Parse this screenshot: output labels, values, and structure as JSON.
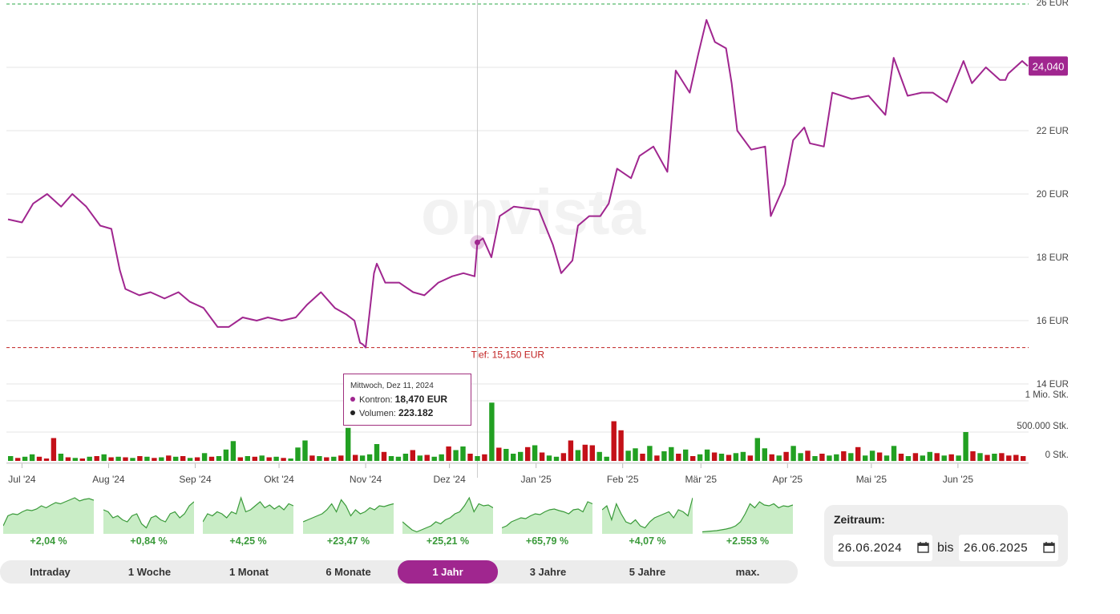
{
  "chart_data": {
    "type": "line",
    "series": [
      {
        "name": "Kontron",
        "x": [
          "2024-06-26",
          "2024-07-01",
          "2024-07-05",
          "2024-07-10",
          "2024-07-15",
          "2024-07-19",
          "2024-07-24",
          "2024-07-29",
          "2024-08-02",
          "2024-08-05",
          "2024-08-07",
          "2024-08-12",
          "2024-08-16",
          "2024-08-21",
          "2024-08-26",
          "2024-08-30",
          "2024-09-04",
          "2024-09-09",
          "2024-09-13",
          "2024-09-18",
          "2024-09-23",
          "2024-09-27",
          "2024-10-02",
          "2024-10-07",
          "2024-10-11",
          "2024-10-16",
          "2024-10-21",
          "2024-10-25",
          "2024-10-28",
          "2024-10-30",
          "2024-10-31",
          "2024-11-01",
          "2024-11-04",
          "2024-11-05",
          "2024-11-08",
          "2024-11-13",
          "2024-11-18",
          "2024-11-22",
          "2024-11-27",
          "2024-12-02",
          "2024-12-06",
          "2024-12-10",
          "2024-12-11",
          "2024-12-13",
          "2024-12-16",
          "2024-12-19",
          "2024-12-24",
          "2025-01-02",
          "2025-01-07",
          "2025-01-10",
          "2025-01-14",
          "2025-01-16",
          "2025-01-20",
          "2025-01-24",
          "2025-01-27",
          "2025-01-30",
          "2025-02-04",
          "2025-02-07",
          "2025-02-12",
          "2025-02-17",
          "2025-02-20",
          "2025-02-25",
          "2025-02-28",
          "2025-03-03",
          "2025-03-06",
          "2025-03-10",
          "2025-03-12",
          "2025-03-14",
          "2025-03-19",
          "2025-03-24",
          "2025-03-26",
          "2025-03-31",
          "2025-04-03",
          "2025-04-07",
          "2025-04-09",
          "2025-04-14",
          "2025-04-17",
          "2025-04-24",
          "2025-04-30",
          "2025-05-06",
          "2025-05-09",
          "2025-05-14",
          "2025-05-19",
          "2025-05-23",
          "2025-05-28",
          "2025-06-03",
          "2025-06-06",
          "2025-06-11",
          "2025-06-16",
          "2025-06-18",
          "2025-06-19",
          "2025-06-24",
          "2025-06-26"
        ],
        "y": [
          19.2,
          19.1,
          19.7,
          20.0,
          19.6,
          20.0,
          19.6,
          19.0,
          18.9,
          17.6,
          17.0,
          16.8,
          16.9,
          16.7,
          16.9,
          16.6,
          16.4,
          15.8,
          15.8,
          16.1,
          16.0,
          16.1,
          16.0,
          16.1,
          16.5,
          16.9,
          16.4,
          16.2,
          16.0,
          15.3,
          15.25,
          15.15,
          17.5,
          17.8,
          17.2,
          17.2,
          16.9,
          16.8,
          17.2,
          17.4,
          17.5,
          17.4,
          18.47,
          18.6,
          18.0,
          19.3,
          19.6,
          19.5,
          18.4,
          17.5,
          17.9,
          19.0,
          19.3,
          19.3,
          19.7,
          20.8,
          20.5,
          21.2,
          21.5,
          20.7,
          23.9,
          23.2,
          24.4,
          25.5,
          24.8,
          24.6,
          23.5,
          22.0,
          21.4,
          21.5,
          19.3,
          20.3,
          21.7,
          22.1,
          21.6,
          21.5,
          23.2,
          23.0,
          23.1,
          22.5,
          24.3,
          23.1,
          23.2,
          23.2,
          22.9,
          24.2,
          23.5,
          24.0,
          23.6,
          23.6,
          23.8,
          24.2,
          24.04
        ]
      }
    ],
    "volume": {
      "name": "Volumen",
      "values": [
        80000,
        50000,
        70000,
        110000,
        70000,
        40000,
        380000,
        120000,
        60000,
        50000,
        40000,
        70000,
        80000,
        110000,
        60000,
        70000,
        60000,
        50000,
        80000,
        70000,
        50000,
        60000,
        90000,
        70000,
        80000,
        50000,
        60000,
        130000,
        70000,
        80000,
        190000,
        330000,
        60000,
        80000,
        70000,
        90000,
        60000,
        70000,
        50000,
        40000,
        223182,
        340000,
        90000,
        80000,
        60000,
        70000,
        90000,
        550000,
        100000,
        90000,
        110000,
        280000,
        150000,
        80000,
        70000,
        120000,
        180000,
        90000,
        100000,
        70000,
        110000,
        240000,
        180000,
        240000,
        120000,
        80000,
        110000,
        970000,
        220000,
        200000,
        120000,
        150000,
        230000,
        260000,
        140000,
        90000,
        70000,
        130000,
        340000,
        180000,
        270000,
        260000,
        150000,
        70000,
        660000,
        510000,
        170000,
        210000,
        120000,
        250000,
        90000,
        160000,
        230000,
        120000,
        190000,
        80000,
        110000,
        190000,
        140000,
        120000,
        100000,
        130000,
        150000,
        90000,
        380000,
        210000,
        110000,
        90000,
        150000,
        250000,
        130000,
        170000,
        80000,
        120000,
        90000,
        110000,
        160000,
        130000,
        230000,
        90000,
        170000,
        140000,
        90000,
        250000,
        120000,
        80000,
        130000,
        90000,
        150000,
        130000,
        90000,
        110000,
        90000,
        480000,
        160000,
        130000,
        100000,
        120000,
        130000,
        90000,
        100000,
        80000
      ],
      "up": [
        1,
        0,
        1,
        1,
        0,
        0,
        0,
        1,
        0,
        1,
        0,
        1,
        0,
        1,
        0,
        1,
        0,
        1,
        0,
        1,
        0,
        1,
        0,
        1,
        0,
        1,
        0,
        1,
        0,
        1,
        1,
        1,
        0,
        1,
        0,
        1,
        0,
        1,
        0,
        1,
        1,
        1,
        0,
        1,
        0,
        1,
        0,
        1,
        0,
        1,
        1,
        1,
        0,
        1,
        1,
        1,
        0,
        1,
        0,
        1,
        1,
        0,
        1,
        1,
        0,
        1,
        0,
        1,
        0,
        1,
        1,
        1,
        0,
        1,
        0,
        1,
        1,
        0,
        0,
        1,
        0,
        0,
        1,
        1,
        0,
        0,
        1,
        1,
        0,
        1,
        0,
        1,
        1,
        0,
        1,
        0,
        1,
        1,
        0,
        1,
        0,
        1,
        1,
        0,
        1,
        1,
        0,
        1,
        0,
        1,
        1,
        0,
        1,
        0,
        1,
        1,
        0,
        1,
        0,
        1,
        1,
        0,
        1,
        1,
        0,
        1,
        0,
        1,
        1,
        0,
        1,
        0,
        1,
        1,
        0,
        1,
        0,
        1,
        0,
        0
      ],
      "ylabels": [
        "1 Mio. Stk.",
        "500.000 Stk.",
        "0 Stk."
      ]
    },
    "x_ticks": [
      "Jul '24",
      "Aug '24",
      "Sep '24",
      "Okt '24",
      "Nov '24",
      "Dez '24",
      "Jan '25",
      "Feb '25",
      "Mär '25",
      "Apr '25",
      "Mai '25",
      "Jun '25"
    ],
    "y_ticks": [
      "14 EUR",
      "16 EUR",
      "18 EUR",
      "20 EUR",
      "22 EUR"
    ],
    "y_top_tick_fragment": "26 EUR",
    "ylim": [
      14,
      26
    ],
    "last_price_label": "24,040",
    "low_line": {
      "value": 15.15,
      "label": "Tief: 15,150 EUR"
    },
    "high_line": {
      "value": 26
    },
    "watermark": "onvista",
    "crosshair_date": "2024-12-11",
    "colors": {
      "line": "#a0268f",
      "up": "#22a022",
      "down": "#c41018",
      "low": "#c02020",
      "high": "#2ea84a"
    }
  },
  "tooltip": {
    "date": "Mittwoch, Dez 11, 2024",
    "price_label": "Kontron:",
    "price_value": "18,470 EUR",
    "volume_label": "Volumen:",
    "volume_value": "223.182"
  },
  "sparklines": [
    {
      "pct": "+2,04 %",
      "points": [
        0.2,
        0.45,
        0.5,
        0.48,
        0.55,
        0.6,
        0.58,
        0.62,
        0.7,
        0.65,
        0.72,
        0.78,
        0.75,
        0.8,
        0.85,
        0.9,
        0.82,
        0.86,
        0.88,
        0.84
      ]
    },
    {
      "pct": "+0,84 %",
      "points": [
        0.6,
        0.55,
        0.4,
        0.45,
        0.35,
        0.3,
        0.45,
        0.5,
        0.25,
        0.15,
        0.4,
        0.45,
        0.35,
        0.3,
        0.5,
        0.55,
        0.4,
        0.5,
        0.7,
        0.8
      ]
    },
    {
      "pct": "+4,25 %",
      "points": [
        0.3,
        0.5,
        0.45,
        0.55,
        0.5,
        0.4,
        0.55,
        0.5,
        0.9,
        0.55,
        0.6,
        0.7,
        0.8,
        0.65,
        0.72,
        0.62,
        0.7,
        0.6,
        0.75,
        0.7
      ]
    },
    {
      "pct": "+23,47 %",
      "points": [
        0.3,
        0.35,
        0.4,
        0.45,
        0.5,
        0.6,
        0.75,
        0.55,
        0.85,
        0.7,
        0.45,
        0.6,
        0.5,
        0.55,
        0.65,
        0.6,
        0.7,
        0.68,
        0.72,
        0.75
      ]
    },
    {
      "pct": "+25,21 %",
      "points": [
        0.3,
        0.2,
        0.1,
        0.05,
        0.1,
        0.15,
        0.2,
        0.3,
        0.25,
        0.35,
        0.4,
        0.5,
        0.55,
        0.7,
        0.9,
        0.55,
        0.75,
        0.7,
        0.72,
        0.65
      ]
    },
    {
      "pct": "+65,79 %",
      "points": [
        0.15,
        0.2,
        0.3,
        0.35,
        0.4,
        0.38,
        0.45,
        0.5,
        0.48,
        0.55,
        0.6,
        0.62,
        0.58,
        0.55,
        0.5,
        0.6,
        0.62,
        0.55,
        0.8,
        0.75
      ]
    },
    {
      "pct": "+4,07 %",
      "points": [
        0.6,
        0.7,
        0.35,
        0.75,
        0.5,
        0.3,
        0.25,
        0.35,
        0.2,
        0.15,
        0.3,
        0.4,
        0.45,
        0.5,
        0.55,
        0.4,
        0.6,
        0.55,
        0.45,
        0.9
      ]
    },
    {
      "pct": "+2.553 %",
      "points": [
        0.05,
        0.06,
        0.07,
        0.08,
        0.1,
        0.12,
        0.15,
        0.2,
        0.3,
        0.5,
        0.75,
        0.65,
        0.8,
        0.72,
        0.7,
        0.75,
        0.65,
        0.7,
        0.68,
        0.72
      ]
    }
  ],
  "ranges": [
    "Intraday",
    "1 Woche",
    "1 Monat",
    "6 Monate",
    "1 Jahr",
    "3 Jahre",
    "5 Jahre",
    "max."
  ],
  "active_range": "1 Jahr",
  "zeitraum": {
    "label": "Zeitraum:",
    "from": "26.06.2024",
    "bis": "bis",
    "to": "26.06.2025"
  }
}
